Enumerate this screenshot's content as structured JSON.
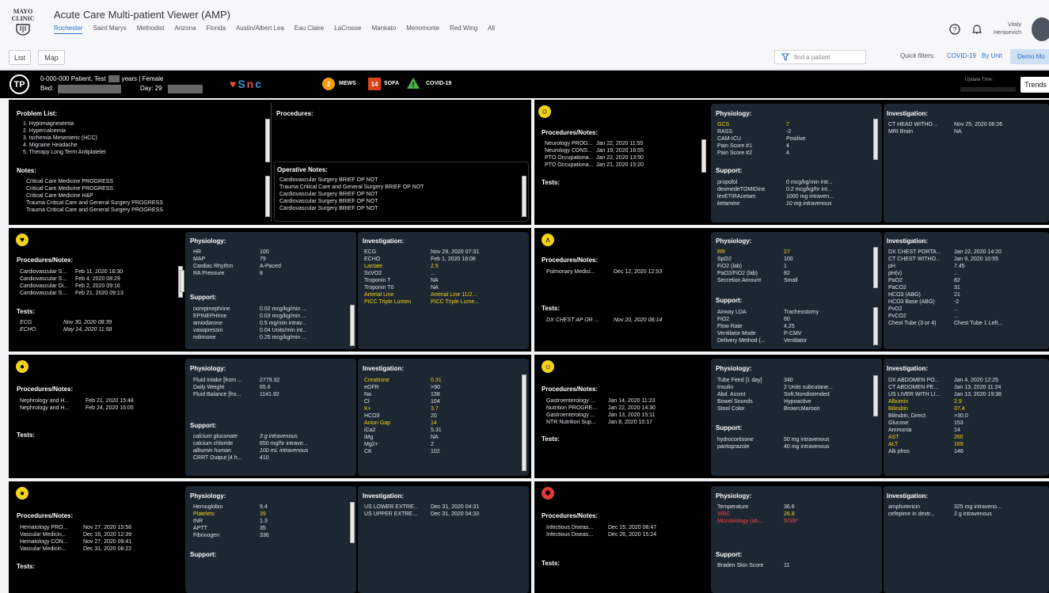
{
  "header": {
    "logo_text": [
      "MAYO",
      "CLINIC"
    ],
    "app_title": "Acute Care Multi-patient Viewer (AMP)",
    "sites": [
      "Rochester",
      "Saint Marys",
      "Methodist",
      "Arizona",
      "Florida",
      "Austin/Albert Lea",
      "Eau Claire",
      "LaCrosse",
      "Mankato",
      "Menomonie",
      "Red Wing",
      "All"
    ],
    "active_site": "Rochester",
    "user_first": "Vitaly",
    "user_last": "Herasevich",
    "help_icon": "?",
    "bell_icon": "bell"
  },
  "toolbar": {
    "list_label": "List",
    "map_label": "Map",
    "search_placeholder": "find a patient",
    "quick_filters_label": "Quick filters:",
    "filters": [
      "COVID-19",
      "By Unit",
      "Demo Mo"
    ]
  },
  "patient": {
    "initials": "TP",
    "name_line": "0-000-000 Patient, Test",
    "age_line": "years | Female",
    "bed_label": "Bed:",
    "day_label": "Day: 29",
    "mews_value": "2",
    "mews_label": "MEWS",
    "sofa_value": "14",
    "sofa_label": "SOFA",
    "covid_label": "COVID-19",
    "update_label": "Update Time:",
    "trends_label": "Trends",
    "colors": {
      "mews": "#f39c12",
      "sofa": "#d9421b",
      "covid": "#4caf50"
    }
  },
  "general": {
    "problem_title": "Problem List:",
    "problems": [
      "1. Hypomagnesemia",
      "2. Hypercalcemia",
      "3. Ischemia Mesenteric (HCC)",
      "4. Migraine Headache",
      "5. Therapy Long Term Antiplatelet"
    ],
    "procedures_title": "Procedures:",
    "notes_title": "Notes:",
    "notes": [
      "Critical Care Medicine PROGRESS",
      "Critical Care Medicine PROGRESS",
      "Critical Care Medicine H&P",
      "Trauma Critical Care and General Surgery PROGRESS",
      "Trauma Critical Care and General Surgery PROGRESS"
    ],
    "op_title": "Operative Notes:",
    "op_notes": [
      "Cardiovascular Surgery BRIEF OP NOT",
      "Trauma Critical Care and General Surgery BRIEF OP NOT",
      "Cardiovascular Surgery BRIEF OP NOT",
      "Cardiovascular Surgery BRIEF OP NOT",
      "Cardiovascular Surgery BRIEF OP NOT"
    ]
  },
  "labels": {
    "procedures_notes": "Procedures/Notes:",
    "tests": "Tests:",
    "physiology": "Physiology:",
    "support": "Support:",
    "investigation": "Investigation:"
  },
  "neuro": {
    "notes": [
      [
        "Neurology PROG...",
        "Jan 22, 2020 11:55"
      ],
      [
        "Neurology CONS...",
        "Jan 19, 2020 16:55"
      ],
      [
        "PTO Occupationa...",
        "Jan 22, 2020 13:50"
      ],
      [
        "PTO Occupationa...",
        "Jan 21, 2020 15:20"
      ]
    ],
    "physiology": [
      [
        "GCS",
        "7",
        "y"
      ],
      [
        "RASS",
        "-2",
        ""
      ],
      [
        "CAM-ICU",
        "Positive",
        ""
      ],
      [
        "Pain Score #1",
        "4",
        ""
      ],
      [
        "Pain Score #2",
        "4",
        ""
      ]
    ],
    "support": [
      [
        "propofol",
        "0 mcg/kg/min intr...",
        ""
      ],
      [
        "dexmedeTOMIDine",
        "0.2 mcg/kg/hr int...",
        ""
      ],
      [
        "levETIRAcetam",
        "1000 mg intraven...",
        ""
      ],
      [
        "ketamine",
        "10 mg intravenous",
        "i"
      ]
    ],
    "investigation": [
      [
        "CT HEAD WITHO...",
        "Nov 25, 2020 06:26"
      ],
      [
        "MRI Brain",
        "NA"
      ]
    ]
  },
  "resp": {
    "notes": [
      [
        "Pulmonary Medici...",
        "Dec 12, 2020 12:53"
      ]
    ],
    "tests": [
      [
        "DX CHEST AP OR ...",
        "Nov 20, 2020 08:14"
      ]
    ],
    "physiology": [
      [
        "RR",
        "27",
        "y"
      ],
      [
        "SpO2",
        "100",
        ""
      ],
      [
        "FiO2 (lab)",
        "1",
        ""
      ],
      [
        "PaO2/FiO2 (lab)",
        "82",
        ""
      ],
      [
        "Secretion Amount",
        "Small",
        ""
      ]
    ],
    "support": [
      [
        "Airway LDA",
        "Tracheostomy"
      ],
      [
        "FiO2",
        "60"
      ],
      [
        "Flow Rate",
        "4.25"
      ],
      [
        "Ventilator Mode",
        "P-CMV"
      ],
      [
        "Delivery Method (...",
        "Ventilator"
      ]
    ],
    "investigation": [
      [
        "DX CHEST PORTA...",
        "Jan 22, 2020 14:20"
      ],
      [
        "CT CHEST WITHO...",
        "Jan 9, 2020 10:55"
      ],
      [
        "pH",
        "7.45"
      ],
      [
        "pH(v)",
        "..."
      ],
      [
        "PaO2",
        "82"
      ],
      [
        "PaCO2",
        "31"
      ],
      [
        "HCO3 (ABG)",
        "21"
      ],
      [
        "HCO3 Base (ABG)",
        "-2"
      ],
      [
        "PvO2",
        "..."
      ],
      [
        "PvCO2",
        "..."
      ],
      [
        "Chest Tube (3 or 4)",
        "Chest Tube 1 Left..."
      ]
    ]
  },
  "cardio": {
    "notes": [
      [
        "Cardiovascular S...",
        "Feb 11, 2020 16:30"
      ],
      [
        "Cardiovascular S...",
        "Feb 4, 2020 08:29"
      ],
      [
        "Cardiovascular Di...",
        "Feb 2, 2020 09:16"
      ],
      [
        "Cardiovascular S...",
        "Feb 21, 2020 09:13"
      ]
    ],
    "tests": [
      [
        "ECG",
        "Nov 30, 2020 08:39"
      ],
      [
        "ECHO",
        "May 14, 2020 11:58"
      ]
    ],
    "physiology": [
      [
        "HR",
        "100"
      ],
      [
        "MAP",
        "79"
      ],
      [
        "Cardiac Rhythm",
        "A-Paced"
      ],
      [
        "RA Pressure",
        "8"
      ]
    ],
    "support": [
      [
        "norepinephrine",
        "0.02 mcg/kg/min ..."
      ],
      [
        "EPINEPHrine",
        "0.03 mcg/kg/min ..."
      ],
      [
        "amiodarone",
        "0.5 mg/min intrav..."
      ],
      [
        "vasopressin",
        "0.04 Units/min int..."
      ],
      [
        "milrinone",
        "0.25 mcg/kg/min ..."
      ]
    ],
    "investigation": [
      [
        "ECG",
        "Nov 29, 2020 07:31",
        ""
      ],
      [
        "ECHO",
        "Feb 1, 2020 16:08",
        ""
      ],
      [
        "Lactate",
        "2.5",
        "y"
      ],
      [
        "ScVO2",
        "...",
        ""
      ],
      [
        "Troponin T",
        "NA",
        ""
      ],
      [
        "Troponin T0",
        "NA",
        ""
      ],
      [
        "Arterial Line",
        "Arterial Line 11/2...",
        "y"
      ],
      [
        "PICC Triple Lumen",
        "PICC Triple Lume...",
        "y"
      ]
    ]
  },
  "gi": {
    "notes": [
      [
        "Gastroenterology ...",
        "Jan 14, 2020 11:23"
      ],
      [
        "Nutrition PROGRE...",
        "Jan 22, 2020 14:30"
      ],
      [
        "Gastroenterology ...",
        "Jan 13, 2020 15:11"
      ],
      [
        "NTR Nutrition Sup...",
        "Jan 8, 2020 10:17"
      ]
    ],
    "physiology": [
      [
        "Tube Feed [1 day]",
        "340"
      ],
      [
        "Insulin",
        "2 Units subcutane..."
      ],
      [
        "Abd. Assmt",
        "Soft,Nondistended"
      ],
      [
        "Bowel Sounds",
        "Hypoactive"
      ],
      [
        "Stool Color",
        "Brown;Maroon"
      ]
    ],
    "support": [
      [
        "hydrocortisone",
        "50 mg intravenous"
      ],
      [
        "pantoprazole",
        "40 mg intravenous"
      ]
    ],
    "investigation": [
      [
        "DX ABDOMEN PO...",
        "Jan 4, 2020 12:25",
        ""
      ],
      [
        "CT ABDOMEN PE...",
        "Jan 13, 2020 11:24",
        ""
      ],
      [
        "US LIVER WITH LI...",
        "Jan 13, 2020 19:38",
        ""
      ],
      [
        "Albumin",
        "2.9",
        "y"
      ],
      [
        "Bilirubin",
        "37.4",
        "y"
      ],
      [
        "Bilirubin, Direct",
        ">30.0",
        ""
      ],
      [
        "Glucose",
        "153",
        ""
      ],
      [
        "Ammonia",
        "14",
        ""
      ],
      [
        "AST",
        "260",
        "y"
      ],
      [
        "ALT",
        "169",
        "y"
      ],
      [
        "Alk phos",
        "146",
        ""
      ]
    ]
  },
  "renal": {
    "notes": [
      [
        "Nephrology and H...",
        "Feb 21, 2020 15:48"
      ],
      [
        "Nephrology and H...",
        "Feb 24, 2020 16:05"
      ]
    ],
    "physiology": [
      [
        "Fluid Intake [from ...",
        "2779.32"
      ],
      [
        "Daily Weight",
        "65.6"
      ],
      [
        "Fluid Balance [fro...",
        "1141.92"
      ]
    ],
    "support": [
      [
        "calcium gluconate",
        "3 g intravenous",
        "i"
      ],
      [
        "calcium chloride",
        "650 mg/hr intrave...",
        ""
      ],
      [
        "albumin human",
        "100 mL intravenous",
        "i"
      ],
      [
        "CRRT Output [4 h...",
        "410",
        ""
      ]
    ],
    "investigation": [
      [
        "Creatinine",
        "0.31",
        "y"
      ],
      [
        "eGFR",
        ">90",
        ""
      ],
      [
        "Na",
        "138",
        ""
      ],
      [
        "Cl",
        "104",
        ""
      ],
      [
        "K+",
        "3.7",
        "y"
      ],
      [
        "HCO3",
        "20",
        ""
      ],
      [
        "Anion Gap",
        "14",
        "y"
      ],
      [
        "iCa2",
        "5.31",
        ""
      ],
      [
        "iMg",
        "NA",
        ""
      ],
      [
        "Mg2+",
        "2",
        ""
      ],
      [
        "CK",
        "102",
        ""
      ]
    ]
  },
  "heme": {
    "notes": [
      [
        "Hematology PRO...",
        "Nov 27, 2020 15:56"
      ],
      [
        "Vascular Medicin...",
        "Dec 16, 2020 12:39"
      ],
      [
        "Hematology CON...",
        "Nov 27, 2020 09:41"
      ],
      [
        "Vascular Medicin...",
        "Dec 31, 2020 08:22"
      ]
    ],
    "physiology": [
      [
        "Hemoglobin",
        "9.4",
        ""
      ],
      [
        "Platelets",
        "39",
        "y"
      ],
      [
        "INR",
        "1.3",
        ""
      ],
      [
        "APTT",
        "35",
        ""
      ],
      [
        "Fibrinogen",
        "336",
        ""
      ]
    ],
    "investigation": [
      [
        "US LOWER EXTRE...",
        "Dec 31, 2020 04:31"
      ],
      [
        "US UPPER EXTRE...",
        "Dec 31, 2020 04:33"
      ]
    ]
  },
  "id": {
    "notes": [
      [
        "Infectious Diseas...",
        "Dec 15, 2020 08:47"
      ],
      [
        "Infectious Diseas...",
        "Dec 26, 2020 15:24"
      ]
    ],
    "physiology": [
      [
        "Temperature",
        "36.6",
        ""
      ],
      [
        "WBC",
        "26.8",
        "y"
      ],
      [
        "Microbiology (ab...",
        "5/3/8*",
        "r"
      ]
    ],
    "support": [
      [
        "Braden Skin Score",
        "11"
      ]
    ],
    "investigation": [
      [
        "amphotericin",
        "325 mg intraveno..."
      ],
      [
        "cefepime in dextr...",
        "2 g intravenous"
      ]
    ]
  }
}
